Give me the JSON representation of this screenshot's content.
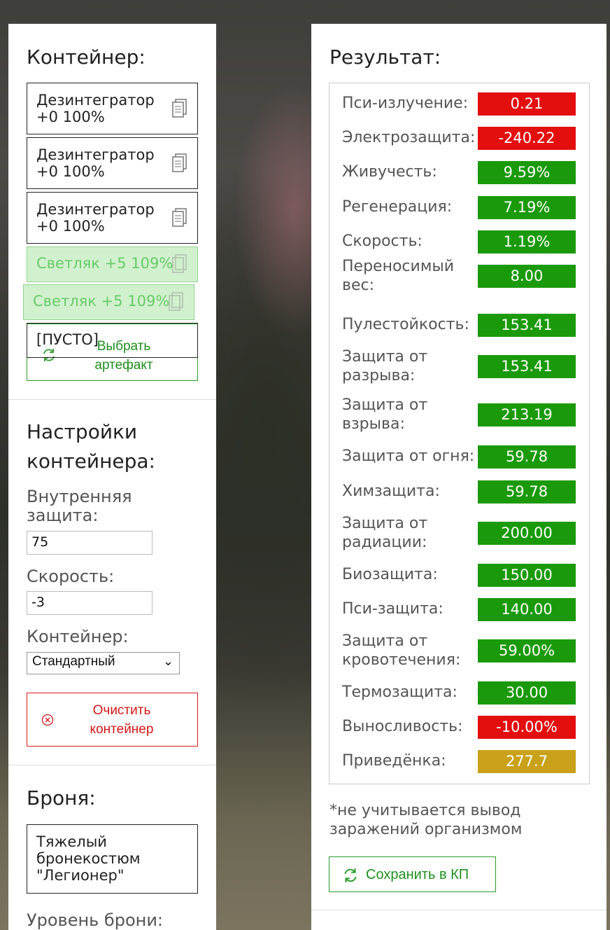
{
  "container": {
    "title": "Контейнер:",
    "slots": [
      {
        "name": "Дезинтегратор",
        "detail": "+0 100%"
      },
      {
        "name": "Дезинтегратор",
        "detail": "+0 100%"
      },
      {
        "name": "Дезинтегратор",
        "detail": "+0 100%"
      }
    ],
    "ghost_slots": [
      {
        "text": "Светляк +5 109%"
      },
      {
        "text": "Светляк +5 109%"
      }
    ],
    "empty_slot": "[ПУСТО]",
    "choose_button": "Выбрать артефакт"
  },
  "settings": {
    "title": "Настройки контейнера:",
    "inner_protection_label": "Внутренняя защита:",
    "inner_protection_value": "75",
    "speed_label": "Скорость:",
    "speed_value": "-3",
    "container_label": "Контейнер:",
    "container_selected": "Стандартный",
    "clear_button": "Очистить контейнер"
  },
  "armor": {
    "title": "Броня:",
    "selected": "Тяжелый бронекостюм \"Легионер\"",
    "level_label": "Уровень брони:"
  },
  "results": {
    "title": "Результат:",
    "rows": [
      {
        "label": "Пси-излучение:",
        "value": "0.21",
        "status": "red"
      },
      {
        "label": "Электрозащита:",
        "value": "-240.22",
        "status": "red"
      },
      {
        "label": "Живучесть:",
        "value": "9.59%",
        "status": "green"
      },
      {
        "label": "Регенерация:",
        "value": "7.19%",
        "status": "green"
      },
      {
        "label": "Скорость:",
        "value": "1.19%",
        "status": "green"
      },
      {
        "label": "Переносимый вес:",
        "value": "8.00",
        "status": "green"
      },
      {
        "label": "Пулестойкость:",
        "value": "153.41",
        "status": "green"
      },
      {
        "label": "Защита от разрыва:",
        "value": "153.41",
        "status": "green"
      },
      {
        "label": "Защита от взрыва:",
        "value": "213.19",
        "status": "green"
      },
      {
        "label": "Защита от огня:",
        "value": "59.78",
        "status": "green"
      },
      {
        "label": "Химзащита:",
        "value": "59.78",
        "status": "green"
      },
      {
        "label": "Защита от радиации:",
        "value": "200.00",
        "status": "green"
      },
      {
        "label": "Биозащита:",
        "value": "150.00",
        "status": "green"
      },
      {
        "label": "Пси-защита:",
        "value": "140.00",
        "status": "green"
      },
      {
        "label": "Защита от кровотечения:",
        "value": "59.00%",
        "status": "green"
      },
      {
        "label": "Термозащита:",
        "value": "30.00",
        "status": "green"
      },
      {
        "label": "Выносливость:",
        "value": "-10.00%",
        "status": "red"
      },
      {
        "label": "Приведёнка:",
        "value": "277.7",
        "status": "gold"
      }
    ],
    "note": "*не учитывается вывод заражений организмом",
    "save_button": "Сохранить в КП"
  },
  "colors": {
    "red": "#e30e0e",
    "green": "#1a9a0a",
    "gold": "#c9a11a",
    "accent_green": "#1f8f1f",
    "danger": "#d01818"
  }
}
